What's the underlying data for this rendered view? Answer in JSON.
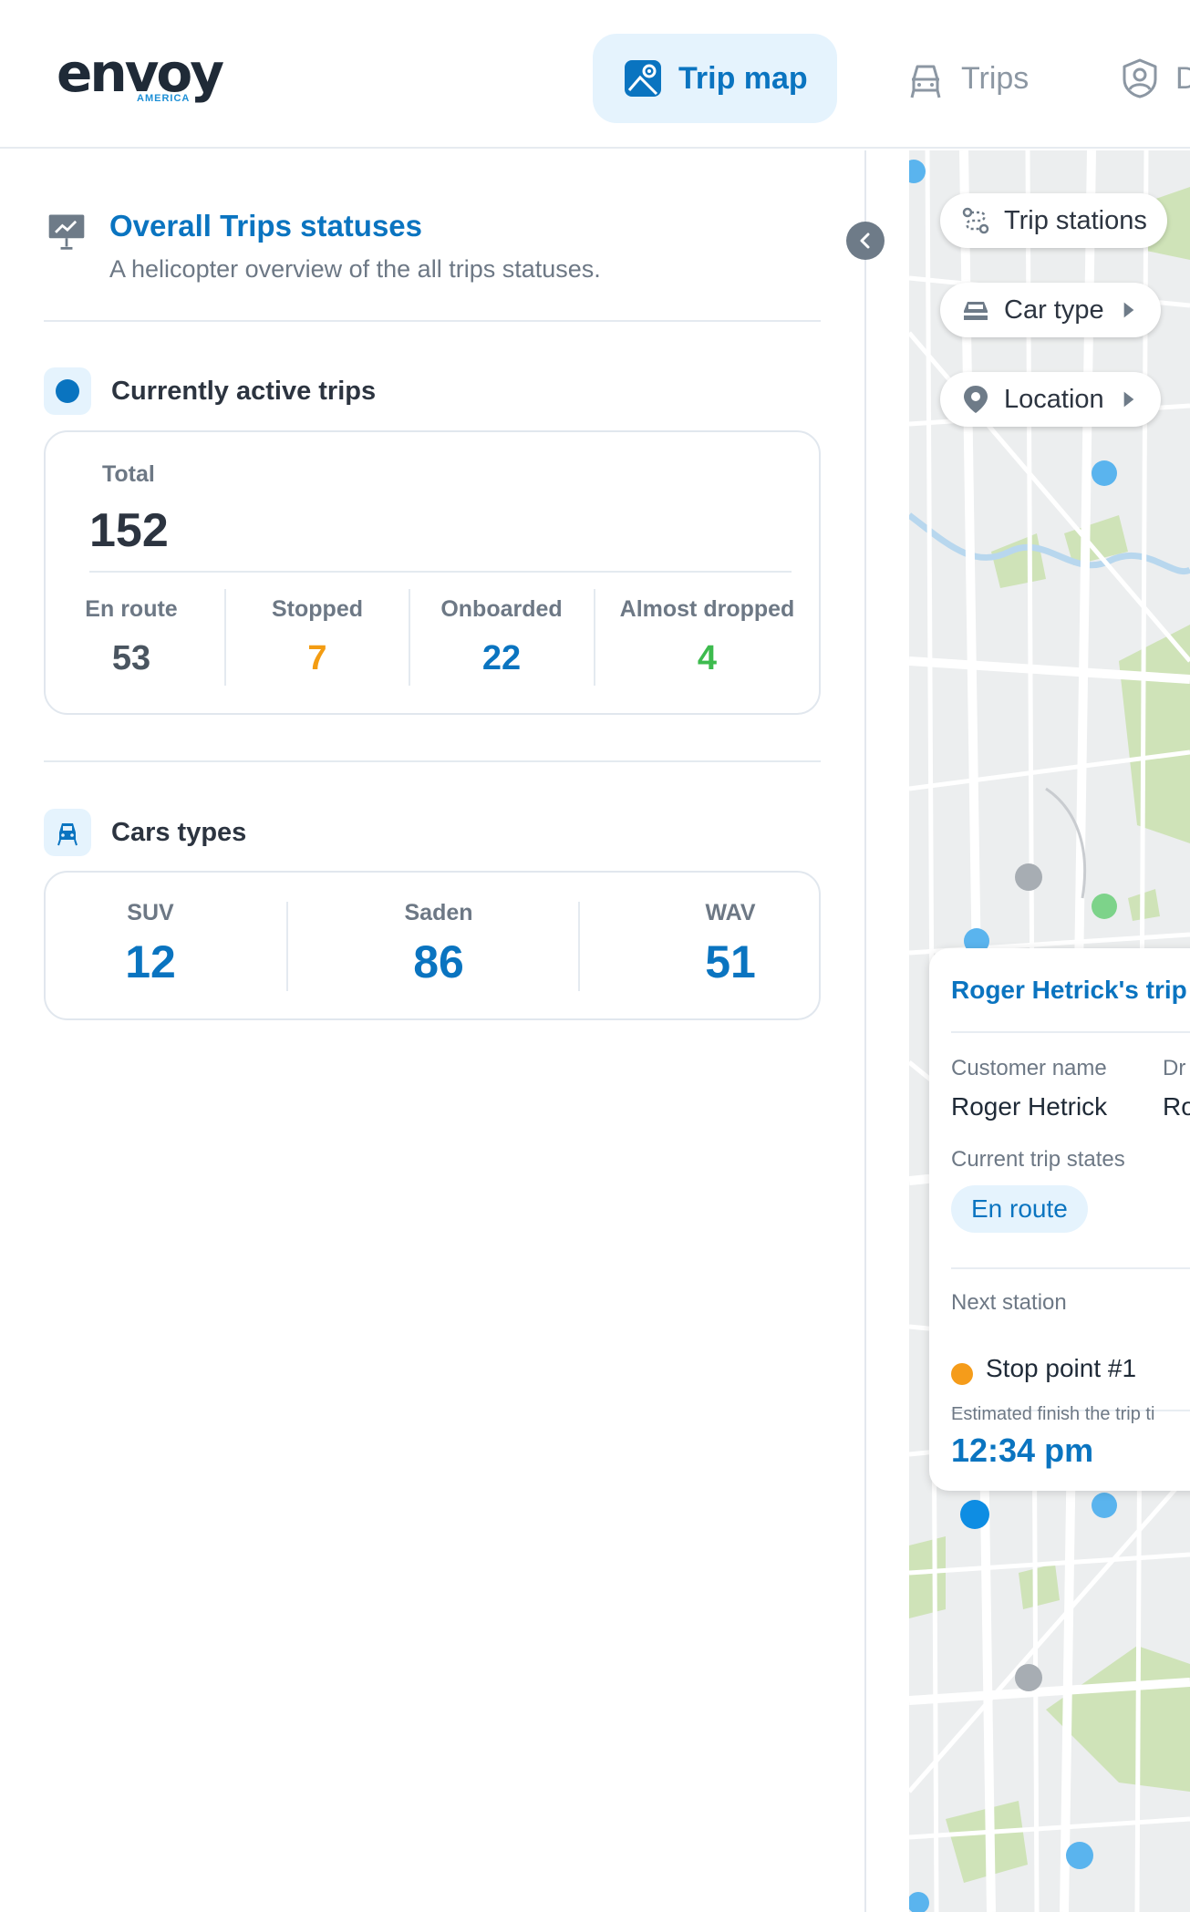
{
  "header": {
    "logo_text": "envoy",
    "logo_sub": "AMERICA",
    "tabs": [
      {
        "label": "Trip map",
        "active": true
      },
      {
        "label": "Trips",
        "active": false
      },
      {
        "label": "D",
        "active": false
      }
    ]
  },
  "overview": {
    "title": "Overall Trips statuses",
    "subtitle": "A helicopter overview of the all trips statuses."
  },
  "active_trips": {
    "title": "Currently active trips",
    "total_label": "Total",
    "total_value": "152",
    "stats": [
      {
        "label": "En route",
        "value": "53",
        "color": "#4a5560"
      },
      {
        "label": "Stopped",
        "value": "7",
        "color": "#f39c12"
      },
      {
        "label": "Onboarded",
        "value": "22",
        "color": "#0a74c0"
      },
      {
        "label": "Almost dropped",
        "value": "4",
        "color": "#3dbb4e"
      }
    ]
  },
  "car_types": {
    "title": "Cars types",
    "items": [
      {
        "label": "SUV",
        "value": "12"
      },
      {
        "label": "Saden",
        "value": "86"
      },
      {
        "label": "WAV",
        "value": "51"
      }
    ]
  },
  "map": {
    "filters": {
      "trip_stations": "Trip stations",
      "car_type": "Car type",
      "location": "Location"
    },
    "trip_card": {
      "title": "Roger Hetrick's trip",
      "customer_label": "Customer name",
      "customer_value": "Roger Hetrick",
      "driver_label": "Dr",
      "driver_value": "Ro",
      "state_label": "Current trip states",
      "state_value": "En route",
      "next_label": "Next station",
      "next_value": "Stop point #1",
      "eta_label": "Estimated finish the trip ti",
      "eta_value": "12:34 pm"
    }
  },
  "colors": {
    "accent": "#0a74c0",
    "accent_bg": "#e5f3fd",
    "stopped": "#f39c12",
    "dropped": "#3dbb4e"
  }
}
